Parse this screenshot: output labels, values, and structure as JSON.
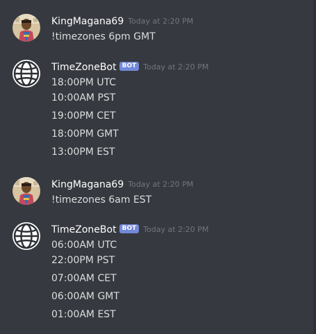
{
  "messages": [
    {
      "author": "KingMagana69",
      "timestamp": "Today at 2:20 PM",
      "lines": [
        "!timezones 6pm GMT"
      ]
    },
    {
      "author": "TimeZoneBot",
      "badge": "BOT",
      "timestamp": "Today at 2:20 PM",
      "lines": [
        "18:00PM UTC",
        "10:00AM PST",
        "19:00PM CET",
        "18:00PM GMT",
        "13:00PM EST"
      ]
    },
    {
      "author": "KingMagana69",
      "timestamp": "Today at 2:20 PM",
      "lines": [
        "!timezones 6am EST"
      ]
    },
    {
      "author": "TimeZoneBot",
      "badge": "BOT",
      "timestamp": "Today at 2:20 PM",
      "lines": [
        "06:00AM UTC",
        "22:00PM PST",
        "07:00AM CET",
        "06:00AM GMT",
        "01:00AM EST"
      ]
    }
  ],
  "colors": {
    "background": "#36393f",
    "username": "#ffffff",
    "message_text": "#dcddde",
    "timestamp": "#72767d",
    "bot_badge": "#7289da"
  },
  "icons": {
    "user_avatar": "user-avatar-photo",
    "bot_avatar": "globe-icon"
  }
}
